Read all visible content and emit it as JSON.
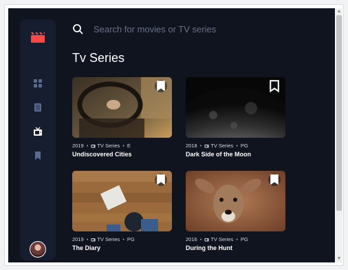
{
  "search": {
    "placeholder": "Search for movies or TV series",
    "value": ""
  },
  "page": {
    "title": "Tv Series"
  },
  "nav": {
    "logo_icon": "film-clapper-icon",
    "items": [
      {
        "name": "home",
        "icon": "grid-icon",
        "active": false
      },
      {
        "name": "movies",
        "icon": "film-icon",
        "active": false
      },
      {
        "name": "tv-series",
        "icon": "tv-icon",
        "active": true
      },
      {
        "name": "bookmarks",
        "icon": "bookmark-icon",
        "active": false
      }
    ]
  },
  "cards": [
    {
      "year": "2019",
      "category": "TV Series",
      "rating": "E",
      "title": "Undiscovered Cities"
    },
    {
      "year": "2018",
      "category": "TV Series",
      "rating": "PG",
      "title": "Dark Side of the Moon"
    },
    {
      "year": "2019",
      "category": "TV Series",
      "rating": "PG",
      "title": "The Diary"
    },
    {
      "year": "2016",
      "category": "TV Series",
      "rating": "PG",
      "title": "During the Hunt"
    }
  ],
  "meta_separator": "•",
  "colors": {
    "background": "#10141e",
    "sidebar": "#161d2f",
    "accent": "#fc4747",
    "nav_inactive": "#5a698f",
    "nav_active": "#ffffff"
  }
}
